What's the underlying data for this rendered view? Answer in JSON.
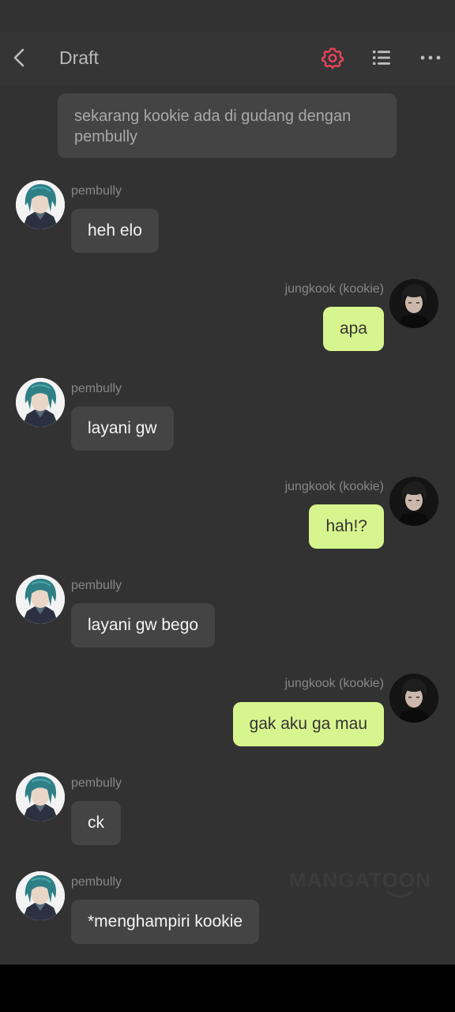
{
  "header": {
    "title": "Draft",
    "back_icon": "chevron-left-icon",
    "settings_icon": "gear-icon",
    "list_icon": "list-icon",
    "more_icon": "more-horizontal-icon",
    "accent_color": "#e8435a"
  },
  "narration": "sekarang kookie ada di gudang dengan pembully",
  "characters": {
    "pembully": "pembully",
    "kookie": "jungkook (kookie)"
  },
  "messages": [
    {
      "side": "left",
      "name": "pembully",
      "text": "heh elo"
    },
    {
      "side": "right",
      "name": "jungkook (kookie)",
      "text": "apa"
    },
    {
      "side": "left",
      "name": "pembully",
      "text": "layani gw"
    },
    {
      "side": "right",
      "name": "jungkook (kookie)",
      "text": "hah!?"
    },
    {
      "side": "left",
      "name": "pembully",
      "text": "layani gw bego"
    },
    {
      "side": "right",
      "name": "jungkook (kookie)",
      "text": "gak aku ga mau"
    },
    {
      "side": "left",
      "name": "pembully",
      "text": "ck"
    },
    {
      "side": "left",
      "name": "pembully",
      "text": "*menghampiri kookie"
    }
  ],
  "watermark": "MANGATOON",
  "colors": {
    "background": "#323232",
    "left_bubble": "#444444",
    "right_bubble": "#d7f58e"
  }
}
